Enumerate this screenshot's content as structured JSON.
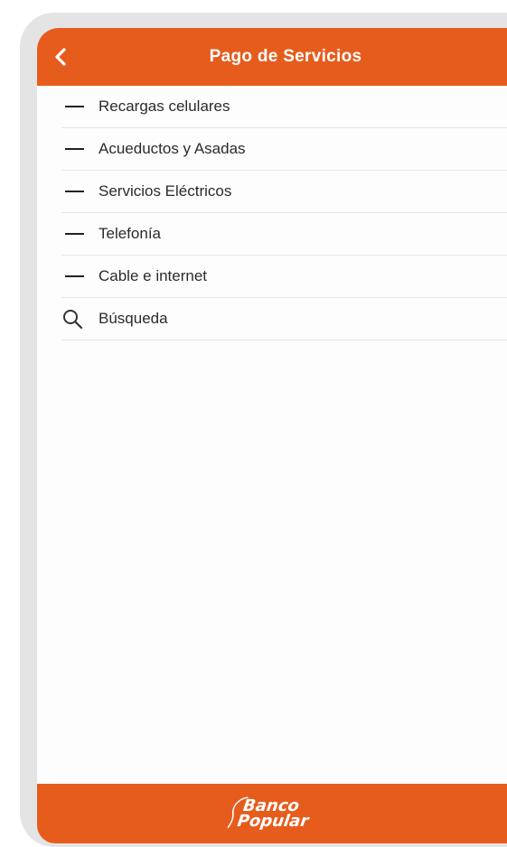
{
  "header": {
    "title": "Pago de Servicios"
  },
  "menu": {
    "items": [
      {
        "label": "Recargas celulares",
        "icon": "dash-icon"
      },
      {
        "label": "Acueductos y Asadas",
        "icon": "dash-icon"
      },
      {
        "label": "Servicios Eléctricos",
        "icon": "dash-icon"
      },
      {
        "label": "Telefonía",
        "icon": "dash-icon"
      },
      {
        "label": "Cable e internet",
        "icon": "dash-icon"
      },
      {
        "label": "Búsqueda",
        "icon": "search-icon"
      }
    ]
  },
  "footer": {
    "logo_line1": "Banco",
    "logo_line2": "Popular"
  },
  "colors": {
    "brand": "#e65c1d",
    "text": "#2b2b2b",
    "divider": "#e6e6e6"
  }
}
